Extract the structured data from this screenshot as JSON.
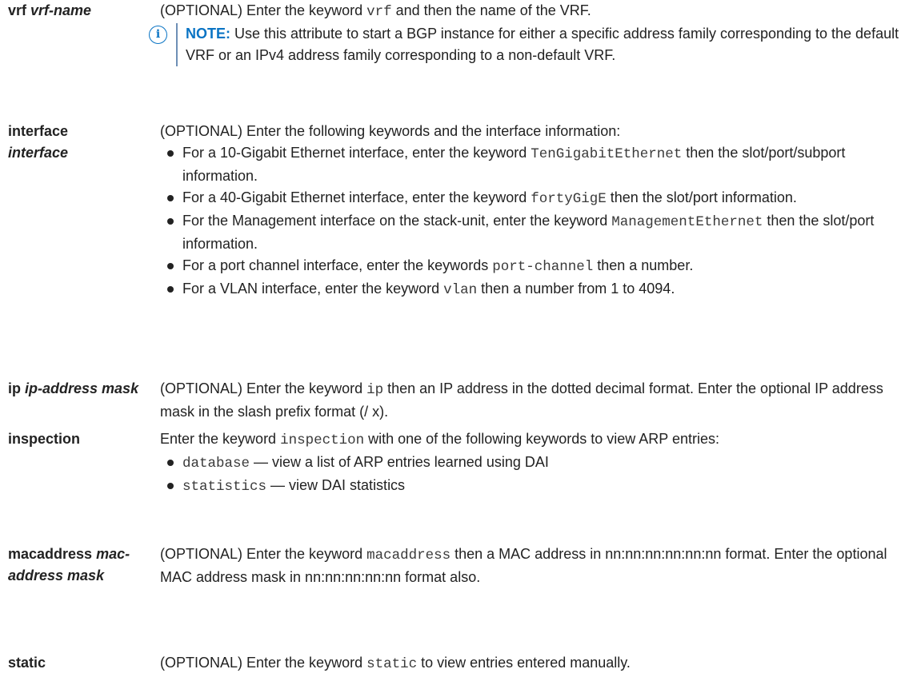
{
  "rows": [
    {
      "term_bold": "vrf",
      "term_arg": "vrf-name",
      "desc_pre": "(OPTIONAL) Enter the keyword ",
      "desc_code": "vrf",
      "desc_post": " and then the name of the VRF.",
      "note_icon": "info-icon",
      "note_label": "NOTE:",
      "note_text": " Use this attribute to start a BGP instance for either a specific address family corresponding to the default VRF or an IPv4 address family corresponding to a non-default VRF."
    },
    {
      "term_bold": "interface",
      "term_arg": "interface",
      "intro": "(OPTIONAL) Enter the following keywords and the interface information:",
      "items": [
        {
          "pre": "For a 10-Gigabit Ethernet interface, enter the keyword ",
          "code": "TenGigabitEthernet",
          "post": " then the slot/port/subport information."
        },
        {
          "pre": "For a 40-Gigabit Ethernet interface, enter the keyword ",
          "code": "fortyGigE",
          "post": " then the slot/port information."
        },
        {
          "pre": "For the Management interface on the stack-unit, enter the keyword ",
          "code": "ManagementEthernet",
          "post": " then the slot/port information."
        },
        {
          "pre": "For a port channel interface, enter the keywords ",
          "code": "port-channel",
          "post": " then a number."
        },
        {
          "pre": "For a VLAN interface, enter the keyword ",
          "code": "vlan",
          "post": " then a number from 1 to 4094."
        }
      ]
    },
    {
      "term_bold": "ip",
      "term_arg": "ip-address mask",
      "desc_pre": "(OPTIONAL) Enter the keyword ",
      "desc_code": "ip",
      "desc_post": " then an IP address in the dotted decimal format. Enter the optional IP address mask in the slash prefix format (/ x)."
    },
    {
      "term_bold": "inspection",
      "desc_pre": "Enter the keyword ",
      "desc_code": "inspection",
      "desc_post": " with one of the following keywords to view ARP entries:",
      "items": [
        {
          "code": "database",
          "post": " — view a list of ARP entries learned using DAI"
        },
        {
          "code": "statistics",
          "post": " — view DAI statistics"
        }
      ]
    },
    {
      "term_bold": "macaddress",
      "term_arg": "mac-address mask",
      "desc_pre": "(OPTIONAL) Enter the keyword ",
      "desc_code": "macaddress",
      "desc_post": " then a MAC address in nn:nn:nn:nn:nn:nn format. Enter the optional MAC address mask in nn:nn:nn:nn:nn format also."
    },
    {
      "term_bold": "static",
      "desc_pre": "(OPTIONAL) Enter the keyword ",
      "desc_code": "static",
      "desc_post": " to view entries entered manually."
    }
  ]
}
